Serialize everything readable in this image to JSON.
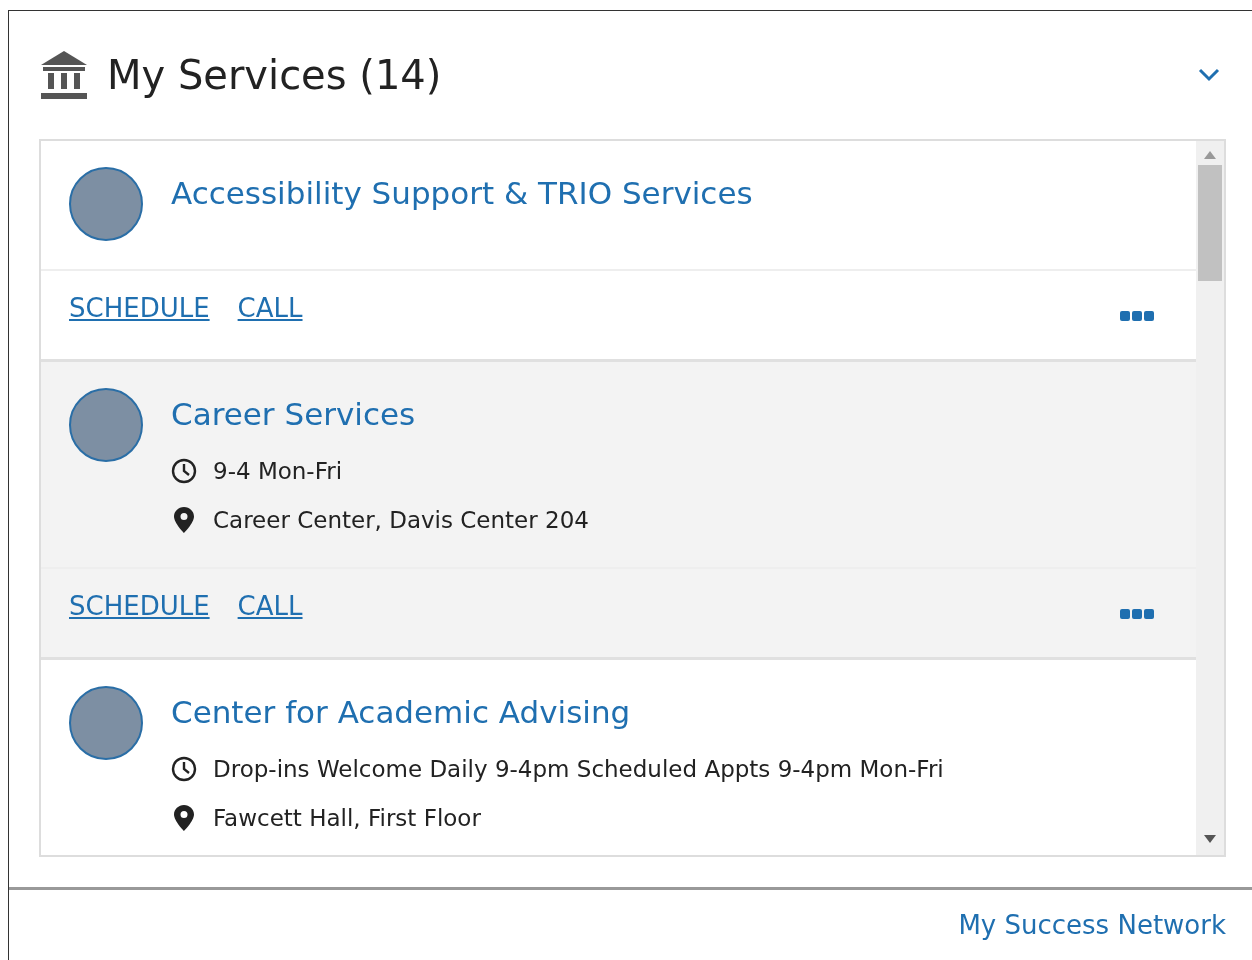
{
  "header": {
    "title": "My Services (14)",
    "expanded": true
  },
  "services": [
    {
      "name": "Accessibility Support & TRIO Services",
      "highlighted": false,
      "actions": [
        "SCHEDULE",
        "CALL"
      ]
    },
    {
      "name": "Career Services",
      "highlighted": true,
      "details": [
        {
          "kind": "hours",
          "text": "9-4 Mon-Fri"
        },
        {
          "kind": "location",
          "text": "Career Center, Davis Center 204"
        }
      ],
      "actions": [
        "SCHEDULE",
        "CALL"
      ]
    },
    {
      "name": "Center for Academic Advising",
      "highlighted": false,
      "details": [
        {
          "kind": "hours",
          "text": "Drop-ins Welcome Daily 9-4pm Scheduled Appts 9-4pm Mon-Fri"
        },
        {
          "kind": "location",
          "text": "Fawcett Hall, First Floor"
        }
      ]
    }
  ],
  "footer": {
    "link": "My Success Network"
  }
}
